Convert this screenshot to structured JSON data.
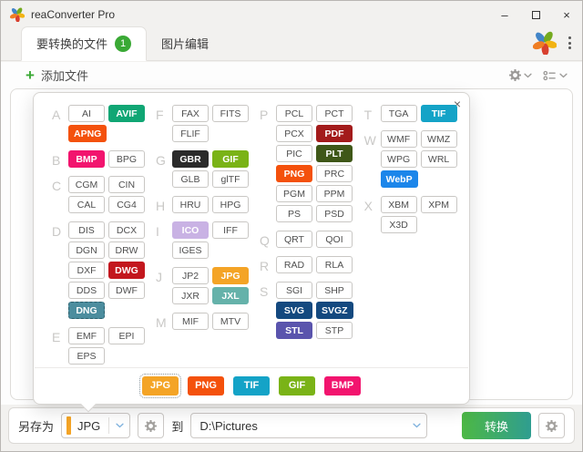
{
  "window": {
    "title": "reaConverter Pro"
  },
  "titlebar": {
    "minimize_glyph": "–",
    "close_glyph": "×"
  },
  "tabs": [
    {
      "label": "要转换的文件",
      "badge": "1",
      "active": true
    },
    {
      "label": "图片编辑",
      "active": false
    }
  ],
  "toolbar": {
    "plus_glyph": "+",
    "add_files_label": "添加文件"
  },
  "dialog": {
    "close_glyph": "×",
    "groups": [
      {
        "sections": [
          {
            "letter": "A",
            "rows": [
              [
                "AI",
                "AVIF"
              ],
              [
                "APNG"
              ]
            ]
          },
          {
            "letter": "B",
            "rows": [
              [
                "BMP",
                "BPG"
              ]
            ]
          },
          {
            "letter": "C",
            "rows": [
              [
                "CGM",
                "CIN"
              ],
              [
                "CAL",
                "CG4"
              ]
            ]
          },
          {
            "letter": "D",
            "rows": [
              [
                "DIS",
                "DCX"
              ],
              [
                "DGN",
                "DRW"
              ],
              [
                "DXF",
                "DWG"
              ],
              [
                "DDS",
                "DWF"
              ],
              [
                "DNG"
              ]
            ]
          },
          {
            "letter": "E",
            "rows": [
              [
                "EMF",
                "EPI"
              ],
              [
                "EPS"
              ]
            ]
          }
        ]
      },
      {
        "sections": [
          {
            "letter": "F",
            "rows": [
              [
                "FAX",
                "FITS"
              ],
              [
                "FLIF"
              ]
            ]
          },
          {
            "letter": "G",
            "rows": [
              [
                "GBR",
                "GIF"
              ],
              [
                "GLB",
                "glTF"
              ]
            ]
          },
          {
            "letter": "H",
            "rows": [
              [
                "HRU",
                "HPG"
              ]
            ]
          },
          {
            "letter": "I",
            "rows": [
              [
                "ICO",
                "IFF"
              ],
              [
                "IGES"
              ]
            ]
          },
          {
            "letter": "J",
            "rows": [
              [
                "JP2",
                "JPG"
              ],
              [
                "JXR",
                "JXL"
              ]
            ]
          },
          {
            "letter": "M",
            "rows": [
              [
                "MIF",
                "MTV"
              ]
            ]
          }
        ]
      },
      {
        "sections": [
          {
            "letter": "P",
            "rows": [
              [
                "PCL",
                "PCT"
              ],
              [
                "PCX",
                "PDF"
              ],
              [
                "PIC",
                "PLT"
              ],
              [
                "PNG",
                "PRC"
              ],
              [
                "PGM",
                "PPM"
              ],
              [
                "PS",
                "PSD"
              ]
            ]
          },
          {
            "letter": "Q",
            "rows": [
              [
                "QRT",
                "QOI"
              ]
            ]
          },
          {
            "letter": "R",
            "rows": [
              [
                "RAD",
                "RLA"
              ]
            ]
          },
          {
            "letter": "S",
            "rows": [
              [
                "SGI",
                "SHP"
              ],
              [
                "SVG",
                "SVGZ"
              ],
              [
                "STL",
                "STP"
              ]
            ]
          }
        ]
      },
      {
        "sections": [
          {
            "letter": "T",
            "rows": [
              [
                "TGA",
                "TIF"
              ]
            ]
          },
          {
            "letter": "W",
            "rows": [
              [
                "WMF",
                "WMZ"
              ],
              [
                "WPG",
                "WRL"
              ],
              [
                "WebP"
              ]
            ]
          },
          {
            "letter": "X",
            "rows": [
              [
                "XBM",
                "XPM"
              ],
              [
                "X3D"
              ]
            ]
          }
        ]
      }
    ],
    "badge_colors": {
      "AVIF": "#10a674",
      "APNG": "#f4510c",
      "BMP": "#f2146e",
      "DWG": "#c3171e",
      "DNG": "#4c8d9e",
      "GBR": "#2b2b2b",
      "GIF": "#7ab317",
      "ICO": "#c9b2e4",
      "JPG": "#f4a426",
      "JXL": "#65b2aa",
      "PDF": "#a31b1b",
      "PLT": "#3f5718",
      "PNG": "#f4510c",
      "SVG": "#14497f",
      "SVGZ": "#14497f",
      "STL": "#5a54ad",
      "TIF": "#14a3c7",
      "WebP": "#1c86ea"
    },
    "selected_format": "DNG",
    "shortcuts": [
      "JPG",
      "PNG",
      "TIF",
      "GIF",
      "BMP"
    ],
    "shortcut_selected": "JPG"
  },
  "bottom": {
    "save_as_label": "另存为",
    "format_value": "JPG",
    "to_label": "到",
    "destination": "D:\\Pictures",
    "convert_label": "转换"
  },
  "icons": {
    "app_logo": "pinwheel-logo",
    "settings": "gear-icon",
    "sort": "sort-list-icon",
    "dropdown": "chevron-down-icon",
    "menu": "kebab-menu-icon"
  },
  "colors": {
    "badge_green": "#3aa935",
    "combo_accent": "#f4a426",
    "chevron_blue": "#7fb2de",
    "convert_gradient_from": "#4db845",
    "convert_gradient_to": "#2f9d90"
  }
}
